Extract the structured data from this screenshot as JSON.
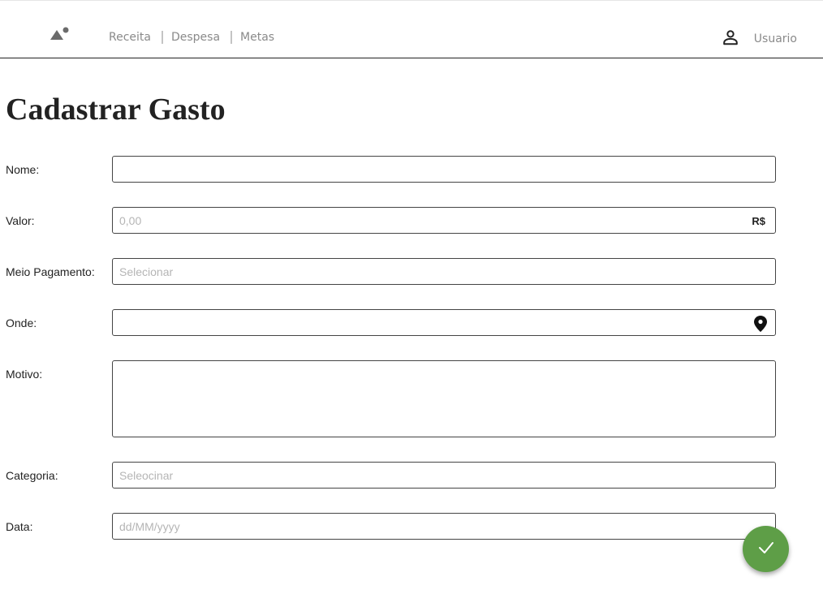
{
  "header": {
    "logo_icon": "landscape-icon",
    "nav": [
      {
        "label": "Receita"
      },
      {
        "label": "Despesa"
      },
      {
        "label": "Metas"
      }
    ],
    "user_icon": "person-icon",
    "user_label": "Usuario"
  },
  "page": {
    "title": "Cadastrar Gasto"
  },
  "form": {
    "nome": {
      "label": "Nome:",
      "value": "",
      "placeholder": ""
    },
    "valor": {
      "label": "Valor:",
      "value": "",
      "placeholder": "0,00",
      "suffix": "R$"
    },
    "meio_pagamento": {
      "label": "Meio Pagamento:",
      "value": "",
      "placeholder": "Selecionar"
    },
    "onde": {
      "label": "Onde:",
      "value": "",
      "placeholder": "",
      "icon": "location-pin-icon"
    },
    "motivo": {
      "label": "Motivo:",
      "value": "",
      "placeholder": ""
    },
    "categoria": {
      "label": "Categoria:",
      "value": "",
      "placeholder": "Seleocinar"
    },
    "data": {
      "label": "Data:",
      "value": "",
      "placeholder": "dd/MM/yyyy"
    }
  },
  "submit": {
    "icon": "check-icon",
    "color": "#5e9e47"
  }
}
